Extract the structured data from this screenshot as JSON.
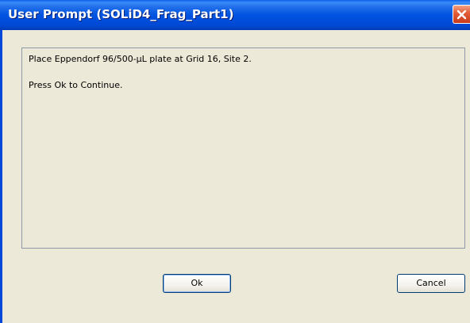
{
  "window": {
    "title": "User Prompt (SOLiD4_Frag_Part1)"
  },
  "message": {
    "line1": "Place Eppendorf 96/500-µL plate at Grid 16, Site 2.",
    "line2": "Press Ok to Continue."
  },
  "buttons": {
    "ok_label": "Ok",
    "cancel_label": "Cancel"
  },
  "icons": {
    "close": "close-icon"
  },
  "colors": {
    "titlebar": "#0053e1",
    "close_button": "#e35f3a",
    "dialog_background": "#ece9d8"
  }
}
